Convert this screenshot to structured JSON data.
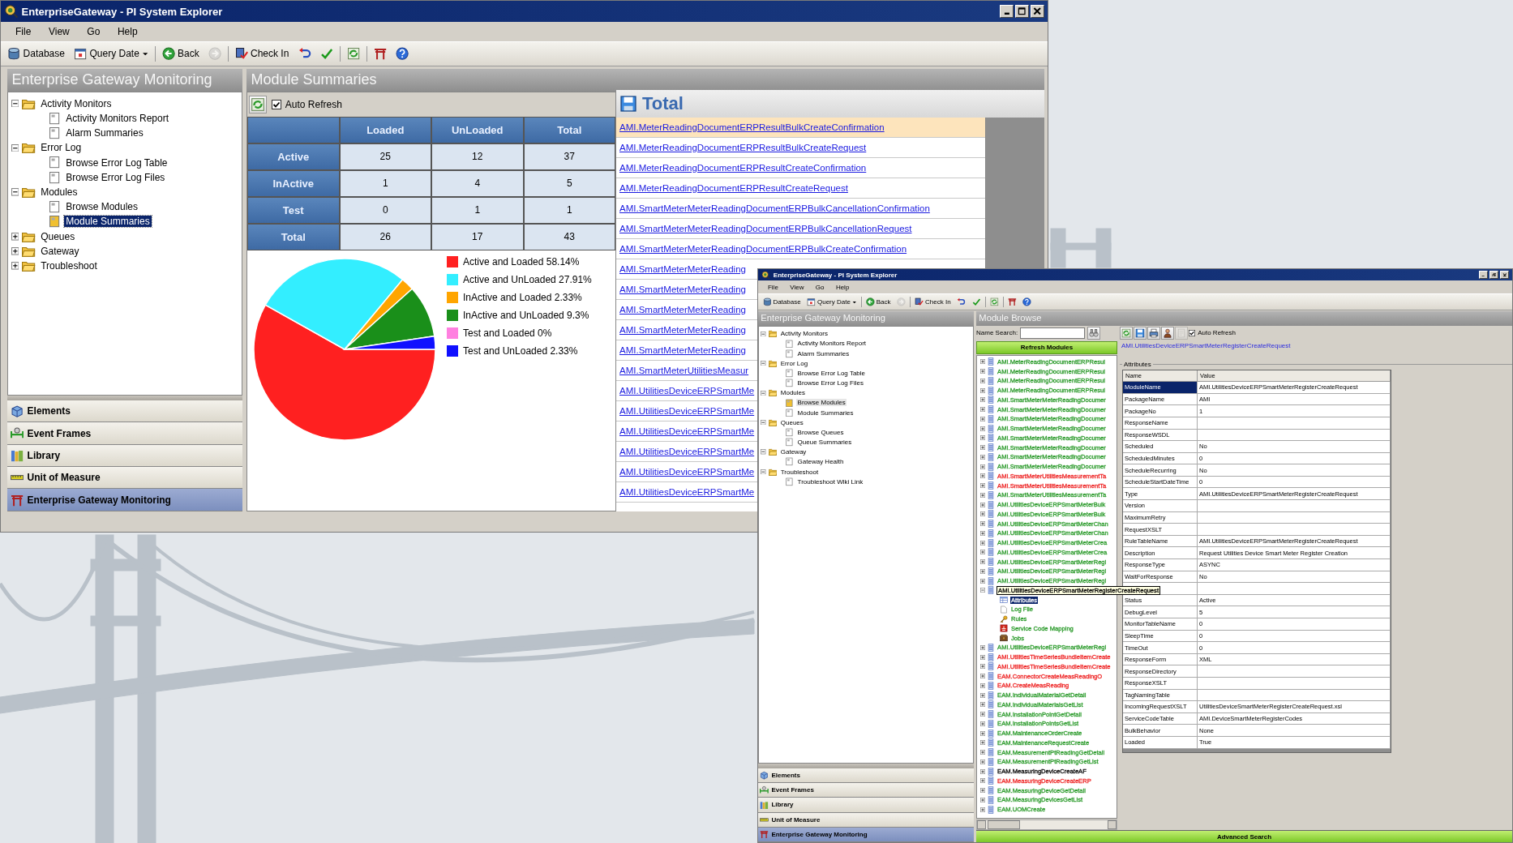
{
  "main_window": {
    "title": "EnterpriseGateway - PI System Explorer",
    "menu": [
      "File",
      "View",
      "Go",
      "Help"
    ],
    "toolbar": [
      {
        "kind": "database",
        "label": "Database",
        "disabled": false
      },
      {
        "kind": "querydate",
        "label": "Query Date",
        "disabled": false
      },
      {
        "kind": "back",
        "label": "Back",
        "disabled": false
      },
      {
        "kind": "forward",
        "disabled": true
      },
      {
        "kind": "checkin",
        "label": "Check In",
        "disabled": false
      },
      {
        "kind": "undo",
        "disabled": false
      },
      {
        "kind": "accept",
        "disabled": false
      },
      {
        "kind": "refresh",
        "disabled": false
      },
      {
        "kind": "gateway",
        "disabled": false
      },
      {
        "kind": "help",
        "disabled": false
      }
    ],
    "nav_panel": {
      "header": "Enterprise Gateway Monitoring",
      "focused": true,
      "tree": [
        {
          "label": "Activity Monitors",
          "kind": "folder",
          "expanded": true,
          "selected": false,
          "children": [
            {
              "label": "Activity Monitors Report",
              "kind": "page",
              "selected": false
            },
            {
              "label": "Alarm Summaries",
              "kind": "page",
              "selected": false
            }
          ]
        },
        {
          "label": "Error Log",
          "kind": "folder",
          "expanded": true,
          "selected": false,
          "children": [
            {
              "label": "Browse Error Log Table",
              "kind": "page",
              "selected": false
            },
            {
              "label": "Browse Error Log Files",
              "kind": "page",
              "selected": false
            }
          ]
        },
        {
          "label": "Modules",
          "kind": "folder",
          "expanded": true,
          "selected": false,
          "children": [
            {
              "label": "Browse Modules",
              "kind": "page",
              "selected": false
            },
            {
              "label": "Module Summaries",
              "kind": "page",
              "selected": true
            }
          ]
        },
        {
          "label": "Queues",
          "kind": "folder",
          "expanded": false,
          "selected": false
        },
        {
          "label": "Gateway",
          "kind": "folder",
          "expanded": false,
          "selected": false
        },
        {
          "label": "Troubleshoot",
          "kind": "folder",
          "expanded": false,
          "selected": false
        }
      ],
      "nav_items": [
        {
          "label": "Elements",
          "kind": "elements",
          "selected": false
        },
        {
          "label": "Event Frames",
          "kind": "eventframes",
          "selected": false
        },
        {
          "label": "Library",
          "kind": "library",
          "selected": false
        },
        {
          "label": "Unit of Measure",
          "kind": "uom",
          "selected": false
        },
        {
          "label": "Enterprise Gateway Monitoring",
          "kind": "gateway",
          "selected": true
        }
      ]
    },
    "module_summaries": {
      "header": "Module Summaries",
      "auto_refresh": {
        "label": "Auto Refresh",
        "checked": true
      },
      "table": {
        "columns": [
          "Loaded",
          "UnLoaded",
          "Total"
        ],
        "rows": [
          {
            "label": "Active",
            "cells": [
              "25",
              "12",
              "37"
            ]
          },
          {
            "label": "InActive",
            "cells": [
              "1",
              "4",
              "5"
            ]
          },
          {
            "label": "Test",
            "cells": [
              "0",
              "1",
              "1"
            ]
          },
          {
            "label": "Total",
            "cells": [
              "26",
              "17",
              "43"
            ]
          }
        ]
      },
      "chart_data": {
        "type": "pie",
        "categories": [
          "Active and Loaded",
          "Active and UnLoaded",
          "InActive and Loaded",
          "InActive and UnLoaded",
          "Test and Loaded",
          "Test and UnLoaded"
        ],
        "values": [
          58.14,
          27.91,
          2.33,
          9.3,
          0,
          2.33
        ],
        "colors": [
          "#ff2020",
          "#33eeff",
          "#ffa500",
          "#1a8f1a",
          "#ff80e0",
          "#1010ff"
        ],
        "value_labels": [
          "58.14%",
          "27.91%",
          "2.33%",
          "9.3%",
          "0%",
          "2.33%"
        ],
        "legend": "right"
      }
    },
    "total": {
      "header": "Total",
      "modules": [
        {
          "label": "AMI.MeterReadingDocumentERPResultBulkCreateConfirmation",
          "selected": true
        },
        {
          "label": "AMI.MeterReadingDocumentERPResultBulkCreateRequest",
          "selected": false
        },
        {
          "label": "AMI.MeterReadingDocumentERPResultCreateConfirmation",
          "selected": false
        },
        {
          "label": "AMI.MeterReadingDocumentERPResultCreateRequest",
          "selected": false
        },
        {
          "label": "AMI.SmartMeterMeterReadingDocumentERPBulkCancellationConfirmation",
          "selected": false
        },
        {
          "label": "AMI.SmartMeterMeterReadingDocumentERPBulkCancellationRequest",
          "selected": false
        },
        {
          "label": "AMI.SmartMeterMeterReadingDocumentERPBulkCreateConfirmation",
          "selected": false
        },
        {
          "label": "AMI.SmartMeterMeterReading",
          "selected": false
        },
        {
          "label": "AMI.SmartMeterMeterReading",
          "selected": false
        },
        {
          "label": "AMI.SmartMeterMeterReading",
          "selected": false
        },
        {
          "label": "AMI.SmartMeterMeterReading",
          "selected": false
        },
        {
          "label": "AMI.SmartMeterMeterReading",
          "selected": false
        },
        {
          "label": "AMI.SmartMeterUtilitiesMeasur",
          "selected": false
        },
        {
          "label": "AMI.UtilitiesDeviceERPSmartMe",
          "selected": false
        },
        {
          "label": "AMI.UtilitiesDeviceERPSmartMe",
          "selected": false
        },
        {
          "label": "AMI.UtilitiesDeviceERPSmartMe",
          "selected": false
        },
        {
          "label": "AMI.UtilitiesDeviceERPSmartMe",
          "selected": false
        },
        {
          "label": "AMI.UtilitiesDeviceERPSmartMe",
          "selected": false
        },
        {
          "label": "AMI.UtilitiesDeviceERPSmartMe",
          "selected": false
        }
      ]
    }
  },
  "second_window": {
    "title": "EnterpriseGateway - PI System Explorer",
    "menu": [
      "File",
      "View",
      "Go",
      "Help"
    ],
    "toolbar": [
      {
        "kind": "database",
        "label": "Database",
        "disabled": false
      },
      {
        "kind": "querydate",
        "label": "Query Date",
        "disabled": false
      },
      {
        "kind": "back",
        "label": "Back",
        "disabled": false
      },
      {
        "kind": "forward",
        "disabled": true
      },
      {
        "kind": "checkin",
        "label": "Check In",
        "disabled": false
      },
      {
        "kind": "undo",
        "disabled": false
      },
      {
        "kind": "accept",
        "disabled": false
      },
      {
        "kind": "refresh",
        "disabled": false
      },
      {
        "kind": "gateway",
        "disabled": false
      },
      {
        "kind": "help",
        "disabled": false
      }
    ],
    "nav_panel": {
      "header": "Enterprise Gateway Monitoring",
      "focused": false,
      "tree": [
        {
          "label": "Activity Monitors",
          "kind": "folder",
          "expanded": true,
          "selected": false,
          "children": [
            {
              "label": "Activity Monitors Report",
              "kind": "page",
              "selected": false
            },
            {
              "label": "Alarm Summaries",
              "kind": "page",
              "selected": false
            }
          ]
        },
        {
          "label": "Error Log",
          "kind": "folder",
          "expanded": true,
          "selected": false,
          "children": [
            {
              "label": "Browse Error Log Table",
              "kind": "page",
              "selected": false
            },
            {
              "label": "Browse Error Log Files",
              "kind": "page",
              "selected": false
            }
          ]
        },
        {
          "label": "Modules",
          "kind": "folder",
          "expanded": true,
          "selected": false,
          "children": [
            {
              "label": "Browse Modules",
              "kind": "page",
              "selected": true
            },
            {
              "label": "Module Summaries",
              "kind": "page",
              "selected": false
            }
          ]
        },
        {
          "label": "Queues",
          "kind": "folder",
          "expanded": true,
          "selected": false,
          "children": [
            {
              "label": "Browse Queues",
              "kind": "page",
              "selected": false
            },
            {
              "label": "Queue Summaries",
              "kind": "page",
              "selected": false
            }
          ]
        },
        {
          "label": "Gateway",
          "kind": "folder",
          "expanded": true,
          "selected": false,
          "children": [
            {
              "label": "Gateway Health",
              "kind": "page",
              "selected": false
            }
          ]
        },
        {
          "label": "Troubleshoot",
          "kind": "folder",
          "expanded": true,
          "selected": false,
          "children": [
            {
              "label": "Troubleshoot Wiki Link",
              "kind": "page",
              "selected": false
            }
          ]
        }
      ],
      "nav_items": [
        {
          "label": "Elements",
          "kind": "elements",
          "selected": false
        },
        {
          "label": "Event Frames",
          "kind": "eventframes",
          "selected": false
        },
        {
          "label": "Library",
          "kind": "library",
          "selected": false
        },
        {
          "label": "Unit of Measure",
          "kind": "uom",
          "selected": false
        },
        {
          "label": "Enterprise Gateway Monitoring",
          "kind": "gateway",
          "selected": true
        }
      ]
    },
    "module_browse": {
      "header": "Module Browse",
      "search_label": "Name Search:",
      "refresh_button": "Refresh Modules",
      "modules": [
        {
          "label": "AMI.MeterReadingDocumentERPResul",
          "color": "#2a9a2a",
          "expanded": false,
          "hovered": false
        },
        {
          "label": "AMI.MeterReadingDocumentERPResul",
          "color": "#2a9a2a",
          "expanded": false,
          "hovered": false
        },
        {
          "label": "AMI.MeterReadingDocumentERPResul",
          "color": "#2a9a2a",
          "expanded": false,
          "hovered": false
        },
        {
          "label": "AMI.MeterReadingDocumentERPResul",
          "color": "#2a9a2a",
          "expanded": false,
          "hovered": false
        },
        {
          "label": "AMI.SmartMeterMeterReadingDocumer",
          "color": "#2a9a2a",
          "expanded": false,
          "hovered": false
        },
        {
          "label": "AMI.SmartMeterMeterReadingDocumer",
          "color": "#2a9a2a",
          "expanded": false,
          "hovered": false
        },
        {
          "label": "AMI.SmartMeterMeterReadingDocumer",
          "color": "#2a9a2a",
          "expanded": false,
          "hovered": false
        },
        {
          "label": "AMI.SmartMeterMeterReadingDocumer",
          "color": "#2a9a2a",
          "expanded": false,
          "hovered": false
        },
        {
          "label": "AMI.SmartMeterMeterReadingDocumer",
          "color": "#2a9a2a",
          "expanded": false,
          "hovered": false
        },
        {
          "label": "AMI.SmartMeterMeterReadingDocumer",
          "color": "#2a9a2a",
          "expanded": false,
          "hovered": false
        },
        {
          "label": "AMI.SmartMeterMeterReadingDocumer",
          "color": "#2a9a2a",
          "expanded": false,
          "hovered": false
        },
        {
          "label": "AMI.SmartMeterMeterReadingDocumer",
          "color": "#2a9a2a",
          "expanded": false,
          "hovered": false
        },
        {
          "label": "AMI.SmartMeterUtilitiesMeasurementTa",
          "color": "#ee2222",
          "expanded": false,
          "hovered": false
        },
        {
          "label": "AMI.SmartMeterUtilitiesMeasurementTa",
          "color": "#ee2222",
          "expanded": false,
          "hovered": false
        },
        {
          "label": "AMI.SmartMeterUtilitiesMeasurementTa",
          "color": "#2a9a2a",
          "expanded": false,
          "hovered": false
        },
        {
          "label": "AMI.UtilitiesDeviceERPSmartMeterBulk",
          "color": "#2a9a2a",
          "expanded": false,
          "hovered": false
        },
        {
          "label": "AMI.UtilitiesDeviceERPSmartMeterBulk",
          "color": "#2a9a2a",
          "expanded": false,
          "hovered": false
        },
        {
          "label": "AMI.UtilitiesDeviceERPSmartMeterChan",
          "color": "#2a9a2a",
          "expanded": false,
          "hovered": false
        },
        {
          "label": "AMI.UtilitiesDeviceERPSmartMeterChan",
          "color": "#2a9a2a",
          "expanded": false,
          "hovered": false
        },
        {
          "label": "AMI.UtilitiesDeviceERPSmartMeterCrea",
          "color": "#2a9a2a",
          "expanded": false,
          "hovered": false
        },
        {
          "label": "AMI.UtilitiesDeviceERPSmartMeterCrea",
          "color": "#2a9a2a",
          "expanded": false,
          "hovered": false
        },
        {
          "label": "AMI.UtilitiesDeviceERPSmartMeterRegi",
          "color": "#2a9a2a",
          "expanded": false,
          "hovered": false
        },
        {
          "label": "AMI.UtilitiesDeviceERPSmartMeterRegi",
          "color": "#2a9a2a",
          "expanded": false,
          "hovered": false
        },
        {
          "label": "AMI.UtilitiesDeviceERPSmartMeterRegi",
          "color": "#2a9a2a",
          "expanded": false,
          "hovered": false
        },
        {
          "label": "AMI.UtilitiesDeviceERPSmartMeterRegisterCreateRequest",
          "expanded": true,
          "hovered": true,
          "children": [
            {
              "label": "Attributes",
              "kind": "attributes",
              "selected": true
            },
            {
              "label": "Log File",
              "kind": "logfile",
              "selected": false
            },
            {
              "label": "Rules",
              "kind": "rules",
              "selected": false
            },
            {
              "label": "Service Code Mapping",
              "kind": "mapping",
              "selected": false
            },
            {
              "label": "Jobs",
              "kind": "jobs",
              "selected": false
            }
          ]
        },
        {
          "label": "AMI.UtilitiesDeviceERPSmartMeterRegi",
          "color": "#2a9a2a",
          "expanded": false,
          "hovered": false
        },
        {
          "label": "AMI.UtilitiesTimeSeriesBundleItemCreate",
          "color": "#ee2222",
          "expanded": false,
          "hovered": false
        },
        {
          "label": "AMI.UtilitiesTimeSeriesBundleItemCreate",
          "color": "#ee2222",
          "expanded": false,
          "hovered": false
        },
        {
          "label": "EAM.ConnectorCreateMeasReadingO",
          "color": "#ee2222",
          "expanded": false,
          "hovered": false
        },
        {
          "label": "EAM.CreateMeasReading",
          "color": "#ee2222",
          "expanded": false,
          "hovered": false
        },
        {
          "label": "EAM.IndividualMaterialGetDetail",
          "color": "#2a9a2a",
          "expanded": false,
          "hovered": false
        },
        {
          "label": "EAM.IndividualMaterialsGetList",
          "color": "#2a9a2a",
          "expanded": false,
          "hovered": false
        },
        {
          "label": "EAM.InstallationPointGetDetail",
          "color": "#2a9a2a",
          "expanded": false,
          "hovered": false
        },
        {
          "label": "EAM.InstallationPointsGetList",
          "color": "#2a9a2a",
          "expanded": false,
          "hovered": false
        },
        {
          "label": "EAM.MaintenanceOrderCreate",
          "color": "#2a9a2a",
          "expanded": false,
          "hovered": false
        },
        {
          "label": "EAM.MaintenanceRequestCreate",
          "color": "#2a9a2a",
          "expanded": false,
          "hovered": false
        },
        {
          "label": "EAM.MeasurementPtReadingGetDetail",
          "color": "#2a9a2a",
          "expanded": false,
          "hovered": false
        },
        {
          "label": "EAM.MeasurementPtReadingGetList",
          "color": "#2a9a2a",
          "expanded": false,
          "hovered": false
        },
        {
          "label": "EAM.MeasuringDeviceCreateAF",
          "color": "#000000",
          "expanded": false,
          "hovered": false
        },
        {
          "label": "EAM.MeasuringDeviceCreateERP",
          "color": "#ee2222",
          "expanded": false,
          "hovered": false
        },
        {
          "label": "EAM.MeasuringDeviceGetDetail",
          "color": "#2a9a2a",
          "expanded": false,
          "hovered": false
        },
        {
          "label": "EAM.MeasuringDevicesGetList",
          "color": "#2a9a2a",
          "expanded": false,
          "hovered": false
        },
        {
          "label": "EAM.UOMCreate",
          "color": "#2a9a2a",
          "expanded": false,
          "hovered": false
        }
      ],
      "advanced_search": "Advanced Search",
      "detail": {
        "tools": [
          {
            "kind": "refresh",
            "disabled": false
          },
          {
            "kind": "save",
            "disabled": false
          },
          {
            "kind": "print",
            "disabled": false
          },
          {
            "kind": "person",
            "disabled": false
          },
          {
            "kind": "doc",
            "disabled": true
          }
        ],
        "auto_refresh": {
          "label": "Auto Refresh",
          "checked": true
        },
        "module_link": "AMI.UtilitiesDeviceERPSmartMeterRegisterCreateRequest",
        "group_label": "Attributes",
        "columns": [
          "Name",
          "Value"
        ],
        "rows": [
          {
            "name": "ModuleName",
            "value": "AMI.UtilitiesDeviceERPSmartMeterRegisterCreateRequest",
            "selected": true
          },
          {
            "name": "PackageName",
            "value": "AMI",
            "selected": false
          },
          {
            "name": "PackageNo",
            "value": "1",
            "selected": false
          },
          {
            "name": "ResponseName",
            "selected": false
          },
          {
            "name": "ResponseWSDL",
            "selected": false
          },
          {
            "name": "Scheduled",
            "value": "No",
            "selected": false
          },
          {
            "name": "ScheduledMinutes",
            "value": "0",
            "selected": false
          },
          {
            "name": "ScheduleRecurring",
            "value": "No",
            "selected": false
          },
          {
            "name": "ScheduleStartDateTime",
            "value": "0",
            "selected": false
          },
          {
            "name": "Type",
            "value": "AMI.UtilitiesDeviceERPSmartMeterRegisterCreateRequest",
            "selected": false
          },
          {
            "name": "Version",
            "selected": false
          },
          {
            "name": "MaximumRetry",
            "selected": false
          },
          {
            "name": "RequestXSLT",
            "selected": false
          },
          {
            "name": "RuleTableName",
            "value": "AMI.UtilitiesDeviceERPSmartMeterRegisterCreateRequest",
            "selected": false
          },
          {
            "name": "Description",
            "value": "Request Utilities Device Smart Meter Register Creation",
            "selected": false
          },
          {
            "name": "ResponseType",
            "value": "ASYNC",
            "selected": false
          },
          {
            "name": "WaitForResponse",
            "value": "No",
            "selected": false
          },
          {
            "selected": false
          },
          {
            "name": "Status",
            "value": "Active",
            "selected": false
          },
          {
            "name": "DebugLevel",
            "value": "5",
            "selected": false
          },
          {
            "name": "MonitorTableName",
            "value": "0",
            "selected": false
          },
          {
            "name": "SleepTime",
            "value": "0",
            "selected": false
          },
          {
            "name": "TimeOut",
            "value": "0",
            "selected": false
          },
          {
            "name": "ResponseForm",
            "value": "XML",
            "selected": false
          },
          {
            "name": "ResponseDirectory",
            "selected": false
          },
          {
            "name": "ResponseXSLT",
            "selected": false
          },
          {
            "name": "TagNamingTable",
            "selected": false
          },
          {
            "name": "IncomingRequestXSLT",
            "value": "UtilitiesDeviceSmartMeterRegisterCreateRequest.xsl",
            "selected": false
          },
          {
            "name": "ServiceCodeTable",
            "value": "AMI.DeviceSmartMeterRegisterCodes",
            "selected": false
          },
          {
            "name": "BulkBehavior",
            "value": "None",
            "selected": false
          },
          {
            "name": "Loaded",
            "value": "True",
            "selected": false
          }
        ]
      }
    }
  }
}
